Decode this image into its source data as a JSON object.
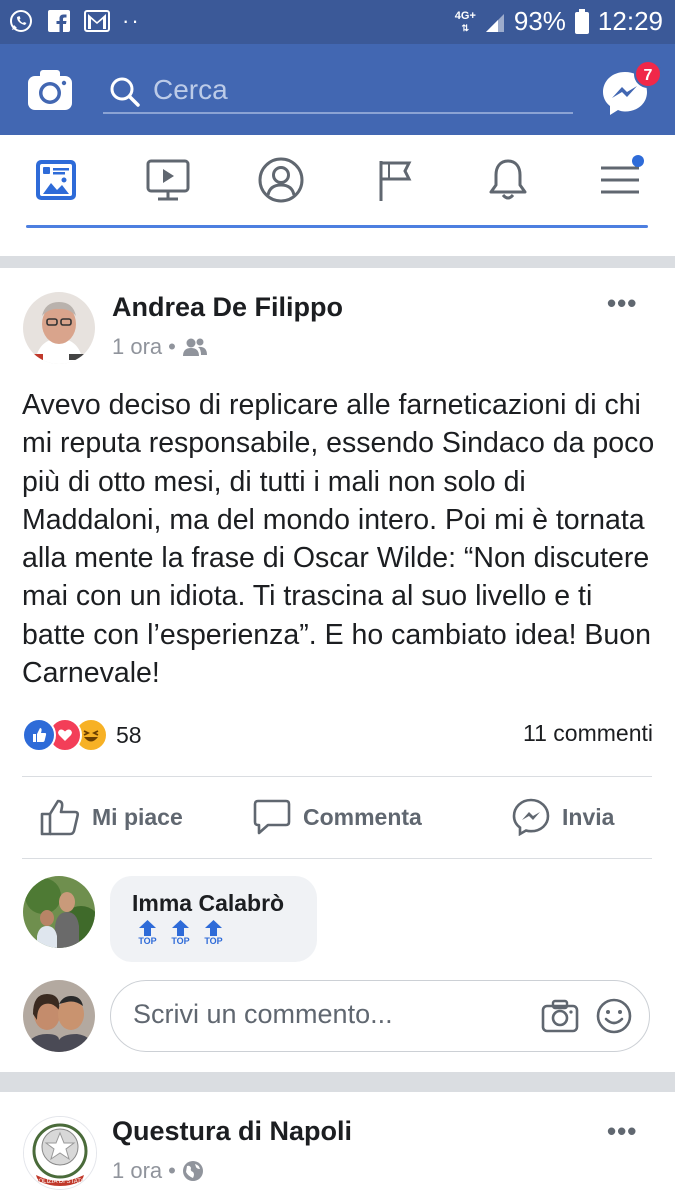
{
  "status_bar": {
    "left_icons": [
      "whatsapp-icon",
      "facebook-icon",
      "gmail-icon"
    ],
    "dots": "··",
    "network": "4G+",
    "battery": "93%",
    "time": "12:29"
  },
  "header": {
    "search_placeholder": "Cerca",
    "messenger_badge": "7",
    "color": "#4267b2"
  },
  "nav": {
    "items": [
      "news-feed-icon",
      "watch-icon",
      "profile-icon",
      "pages-icon",
      "notifications-icon",
      "menu-icon"
    ]
  },
  "posts": [
    {
      "author": "Andrea De Filippo",
      "time": "1 ora",
      "audience": "friends-icon",
      "text": "Avevo deciso di replicare alle farneticazioni di chi mi reputa responsabile, essendo Sindaco da poco più di otto mesi, di tutti i mali non solo di Maddaloni, ma del mondo intero. Poi mi è tornata alla mente la frase di Oscar Wilde: “Non discutere mai con un idiota. Ti trascina al suo livello e ti batte con l’esperienza”. E ho cambiato idea! Buon Carnevale!",
      "reaction_count": "58",
      "comment_count": "11 commenti",
      "actions": {
        "like": "Mi piace",
        "comment": "Commenta",
        "share": "Invia"
      },
      "top_comment": {
        "author": "Imma Calabrò",
        "stickers": [
          "TOP",
          "TOP",
          "TOP"
        ]
      },
      "write_placeholder": "Scrivi un commento..."
    },
    {
      "author": "Questura di Napoli",
      "time": "1 ora",
      "audience": "globe-icon",
      "avatar_text": "POLIZIA DI STATO"
    }
  ]
}
